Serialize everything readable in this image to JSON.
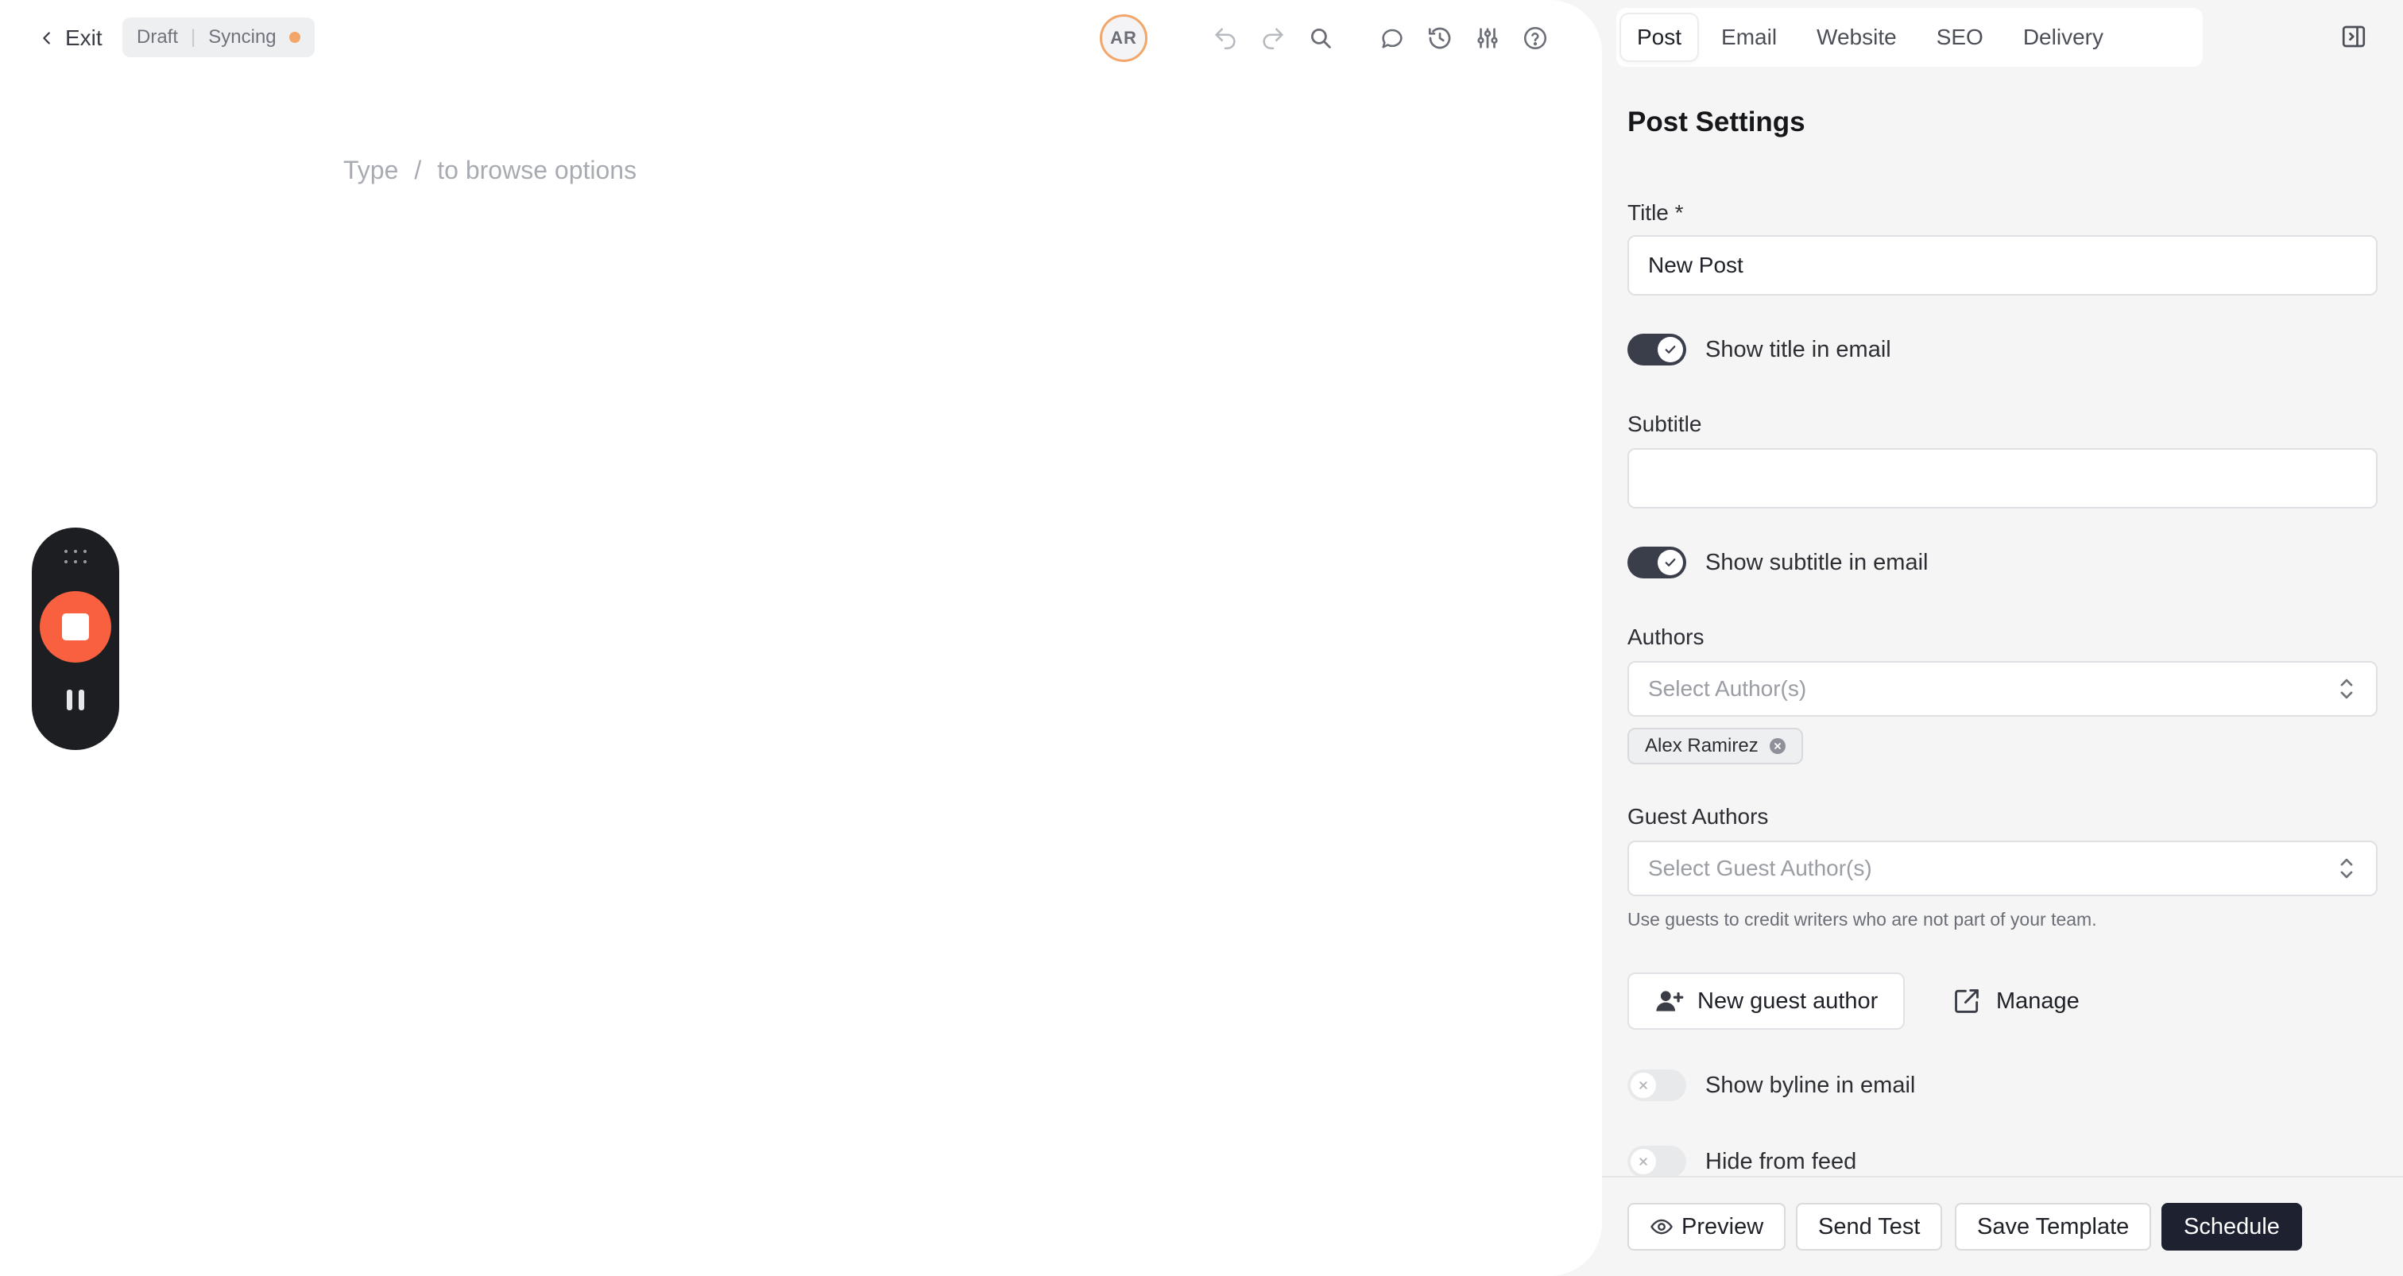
{
  "editor": {
    "exit_label": "Exit",
    "status_draft": "Draft",
    "status_separator": "|",
    "status_sync": "Syncing",
    "avatar_initials": "AR",
    "placeholder_type": "Type",
    "placeholder_slash": "/",
    "placeholder_rest": "to browse options",
    "toolbar_icons": [
      "undo-icon",
      "redo-icon",
      "search-icon",
      "comment-icon",
      "history-icon",
      "sliders-icon",
      "help-icon"
    ]
  },
  "recorder": {
    "icons": [
      "drag-grip-icon",
      "stop-icon",
      "pause-icon"
    ],
    "stop_color": "#f8603f"
  },
  "panel": {
    "tabs": [
      {
        "label": "Post",
        "active": true
      },
      {
        "label": "Email",
        "active": false
      },
      {
        "label": "Website",
        "active": false
      },
      {
        "label": "SEO",
        "active": false
      },
      {
        "label": "Delivery",
        "active": false
      }
    ],
    "heading": "Post Settings",
    "title_label": "Title *",
    "title_value": "New Post",
    "show_title_label": "Show title in email",
    "show_title_on": true,
    "subtitle_label": "Subtitle",
    "subtitle_value": "",
    "show_subtitle_label": "Show subtitle in email",
    "show_subtitle_on": true,
    "authors_label": "Authors",
    "authors_placeholder": "Select Author(s)",
    "author_chip": "Alex Ramirez",
    "guest_label": "Guest Authors",
    "guest_placeholder": "Select Guest Author(s)",
    "guest_help": "Use guests to credit writers who are not part of your team.",
    "new_guest_label": "New guest author",
    "manage_label": "Manage",
    "byline_label": "Show byline in email",
    "byline_on": false,
    "hide_feed_label": "Hide from feed",
    "hide_feed_on": false
  },
  "footer": {
    "preview_label": "Preview",
    "send_test_label": "Send Test",
    "save_template_label": "Save Template",
    "schedule_label": "Schedule"
  },
  "colors": {
    "accent_dark": "#1e2230",
    "status_dot": "#f4a56a",
    "avatar_ring": "#f2a66a"
  }
}
